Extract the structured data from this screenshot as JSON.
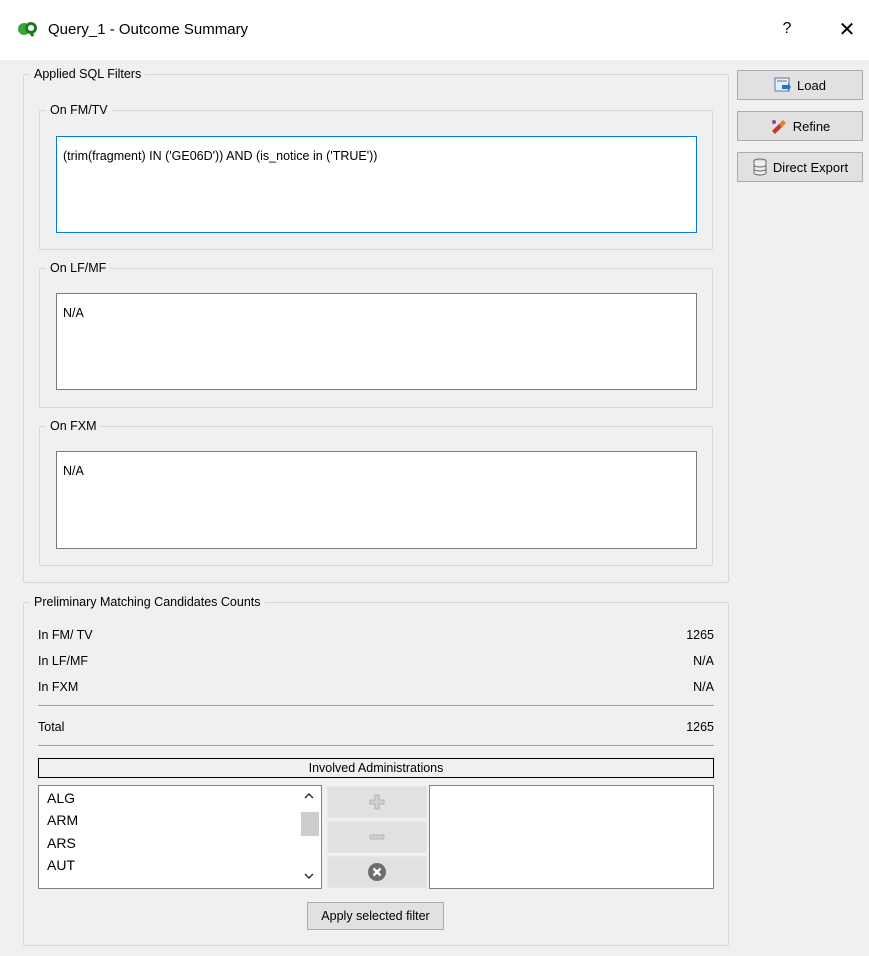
{
  "window": {
    "title": "Query_1 - Outcome Summary",
    "help_label": "?",
    "close_label": "✕"
  },
  "filters": {
    "group_title": "Applied SQL Filters",
    "fm_tv": {
      "title": "On FM/TV",
      "value": "(trim(fragment) IN ('GE06D')) AND (is_notice in ('TRUE'))"
    },
    "lf_mf": {
      "title": "On LF/MF",
      "value": "N/A"
    },
    "fxm": {
      "title": "On FXM",
      "value": "N/A"
    }
  },
  "actions": {
    "load_label": "Load",
    "refine_label": "Refine",
    "export_label": "Direct Export"
  },
  "counts": {
    "group_title": "Preliminary Matching Candidates Counts",
    "rows": [
      {
        "label": "In FM/ TV",
        "value": "1265"
      },
      {
        "label": "In LF/MF",
        "value": "N/A"
      },
      {
        "label": "In FXM",
        "value": "N/A"
      }
    ],
    "total": {
      "label": "Total",
      "value": "1265"
    }
  },
  "administrations": {
    "header": "Involved Administrations",
    "available": [
      "ALG",
      "ARM",
      "ARS",
      "AUT"
    ],
    "apply_label": "Apply selected filter"
  },
  "colors": {
    "accent_border": "#0a78d7",
    "icon_green": "#2e9e2e"
  }
}
